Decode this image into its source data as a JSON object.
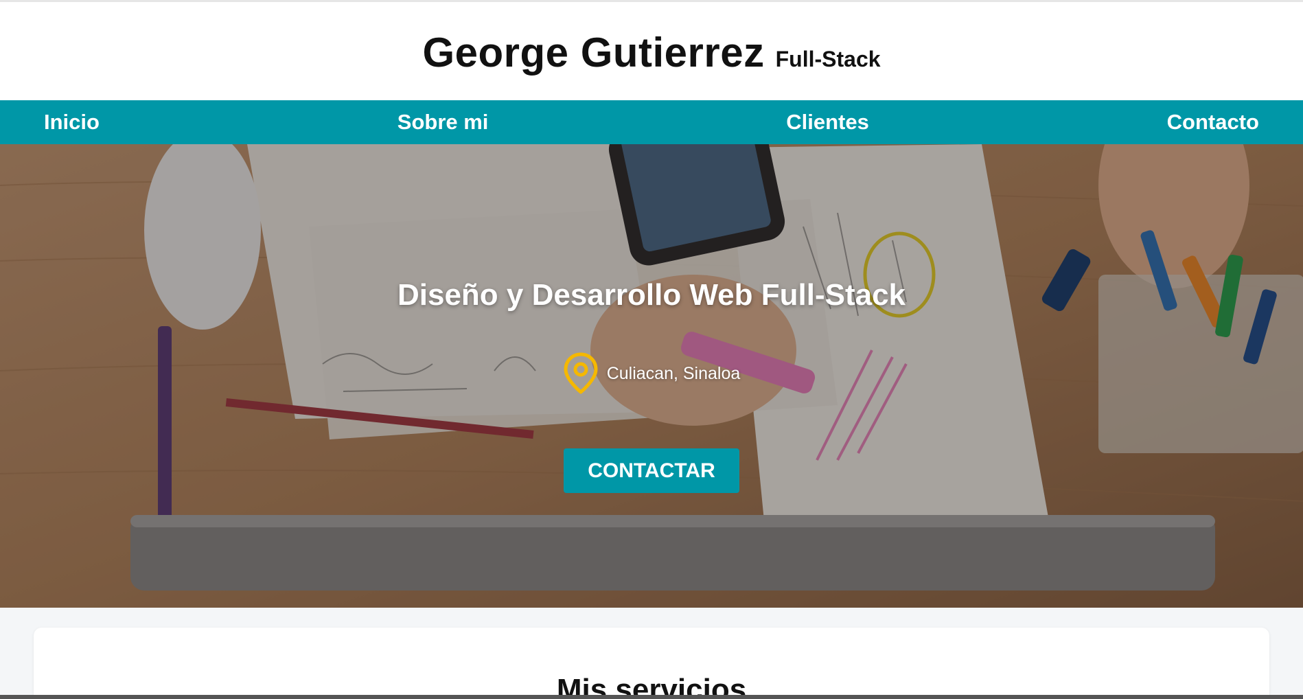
{
  "header": {
    "name": "George Gutierrez",
    "role": "Full-Stack"
  },
  "nav": {
    "items": [
      {
        "label": "Inicio"
      },
      {
        "label": "Sobre mi"
      },
      {
        "label": "Clientes"
      },
      {
        "label": "Contacto"
      }
    ]
  },
  "hero": {
    "title": "Diseño y Desarrollo Web Full-Stack",
    "location": "Culiacan, Sinaloa",
    "location_icon": "map-pin-icon",
    "cta_label": "CONTACTAR"
  },
  "services": {
    "title": "Mis servicios"
  },
  "colors": {
    "accent": "#0097a7",
    "pin": "#f5b800"
  }
}
